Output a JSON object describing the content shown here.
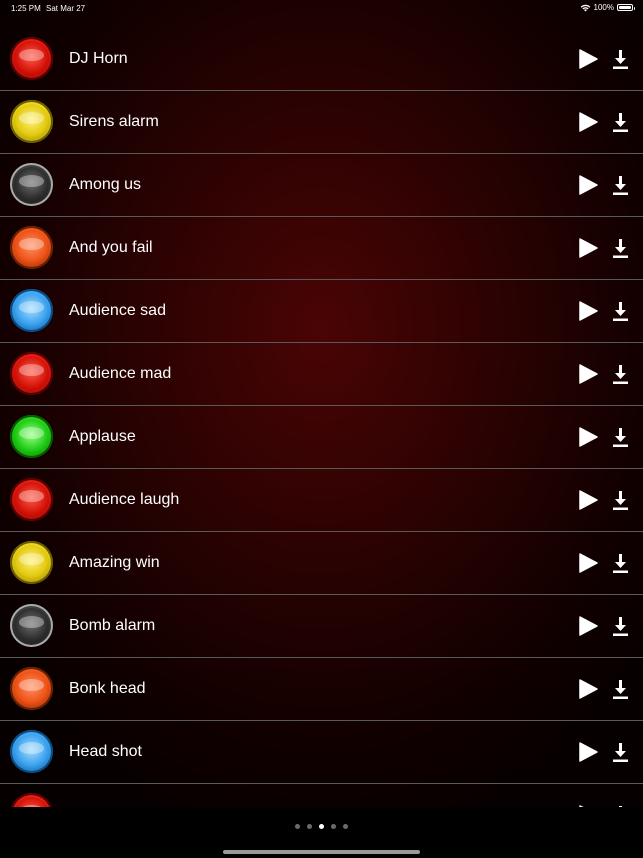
{
  "status_bar": {
    "time": "1:25 PM",
    "date": "Sat Mar 27",
    "battery": "100%",
    "battery_level": 1.0
  },
  "sounds": [
    {
      "name": "DJ Horn",
      "color": "red"
    },
    {
      "name": "Sirens alarm",
      "color": "yellow"
    },
    {
      "name": "Among us",
      "color": "black"
    },
    {
      "name": "And you fail",
      "color": "orange"
    },
    {
      "name": "Audience sad",
      "color": "blue"
    },
    {
      "name": "Audience mad",
      "color": "red"
    },
    {
      "name": "Applause",
      "color": "green"
    },
    {
      "name": "Audience laugh",
      "color": "red"
    },
    {
      "name": "Amazing win",
      "color": "yellow"
    },
    {
      "name": "Bomb alarm",
      "color": "black"
    },
    {
      "name": "Bonk head",
      "color": "orange"
    },
    {
      "name": "Head shot",
      "color": "blue"
    },
    {
      "name": "",
      "color": "red"
    }
  ],
  "icons": {
    "play": "play-icon",
    "download": "download-icon"
  },
  "page_indicator": {
    "count": 5,
    "active_index": 2
  }
}
